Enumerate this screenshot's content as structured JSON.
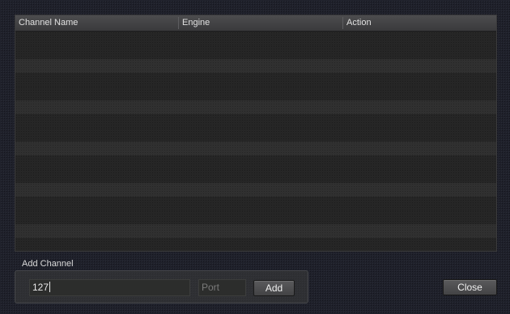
{
  "table": {
    "columns": [
      {
        "label": "Channel Name"
      },
      {
        "label": "Engine"
      },
      {
        "label": "Action"
      }
    ],
    "rows": []
  },
  "add_channel": {
    "group_label": "Add Channel",
    "host_value": "127",
    "port_placeholder": "Port",
    "add_label": "Add"
  },
  "close_label": "Close"
}
